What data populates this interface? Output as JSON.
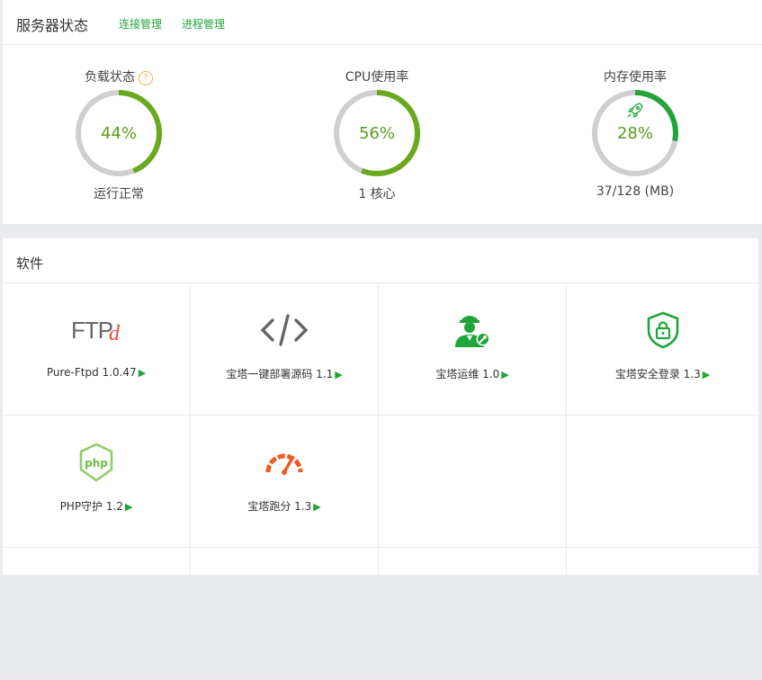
{
  "header": {
    "title": "服务器状态",
    "links": [
      "连接管理",
      "进程管理"
    ]
  },
  "gauges": [
    {
      "title": "负载状态",
      "value": 0.44,
      "percent": "44%",
      "sub": "运行正常",
      "help": "?"
    },
    {
      "title": "CPU使用率",
      "value": 0.56,
      "percent": "56%",
      "sub": "1 核心"
    },
    {
      "title": "内存使用率",
      "value": 0.28,
      "percent": "28%",
      "sub": "37/128 (MB)"
    }
  ],
  "colors": {
    "accent": "#20a53a",
    "gauge_fill_load_cpu": "#6aa91e",
    "gauge_fill_mem": "#20a53a",
    "gauge_track": "#cfcfcf",
    "php_shield": "#8ccf6a",
    "speed_icon": "#f05a24"
  },
  "software": {
    "title": "软件",
    "arrow": "▶",
    "items": [
      {
        "label": "Pure-Ftpd 1.0.47",
        "icon": "ftpd-logo"
      },
      {
        "label": "宝塔一键部署源码 1.1",
        "icon": "code-icon"
      },
      {
        "label": "宝塔运维 1.0",
        "icon": "ops-worker-icon"
      },
      {
        "label": "宝塔安全登录 1.3",
        "icon": "shield-lock-icon"
      },
      {
        "label": "PHP守护 1.2",
        "icon": "php-shield-icon"
      },
      {
        "label": "宝塔跑分 1.3",
        "icon": "speedometer-icon"
      }
    ]
  }
}
